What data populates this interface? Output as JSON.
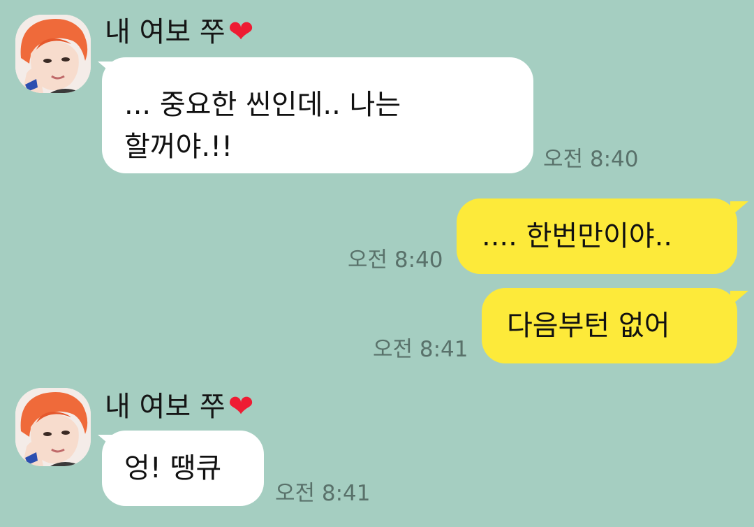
{
  "contact": {
    "name": "내 여보 쭈",
    "heart": "❤"
  },
  "colors": {
    "background": "#a5cec1",
    "incoming_bubble": "#ffffff",
    "outgoing_bubble": "#fdea3a",
    "timestamp": "#59716a",
    "heart": "#ee1c33"
  },
  "messages": [
    {
      "direction": "incoming",
      "lines": [
        "... 중요한 씬인데.. 나는",
        "할꺼야.!!"
      ],
      "time": "오전 8:40"
    },
    {
      "direction": "outgoing",
      "lines": [
        ".... 한번만이야.."
      ],
      "time": "오전 8:40"
    },
    {
      "direction": "outgoing",
      "lines": [
        "다음부턴 없어"
      ],
      "time": "오전 8:41"
    },
    {
      "direction": "incoming",
      "lines": [
        "엉! 땡큐"
      ],
      "time": "오전 8:41"
    }
  ]
}
